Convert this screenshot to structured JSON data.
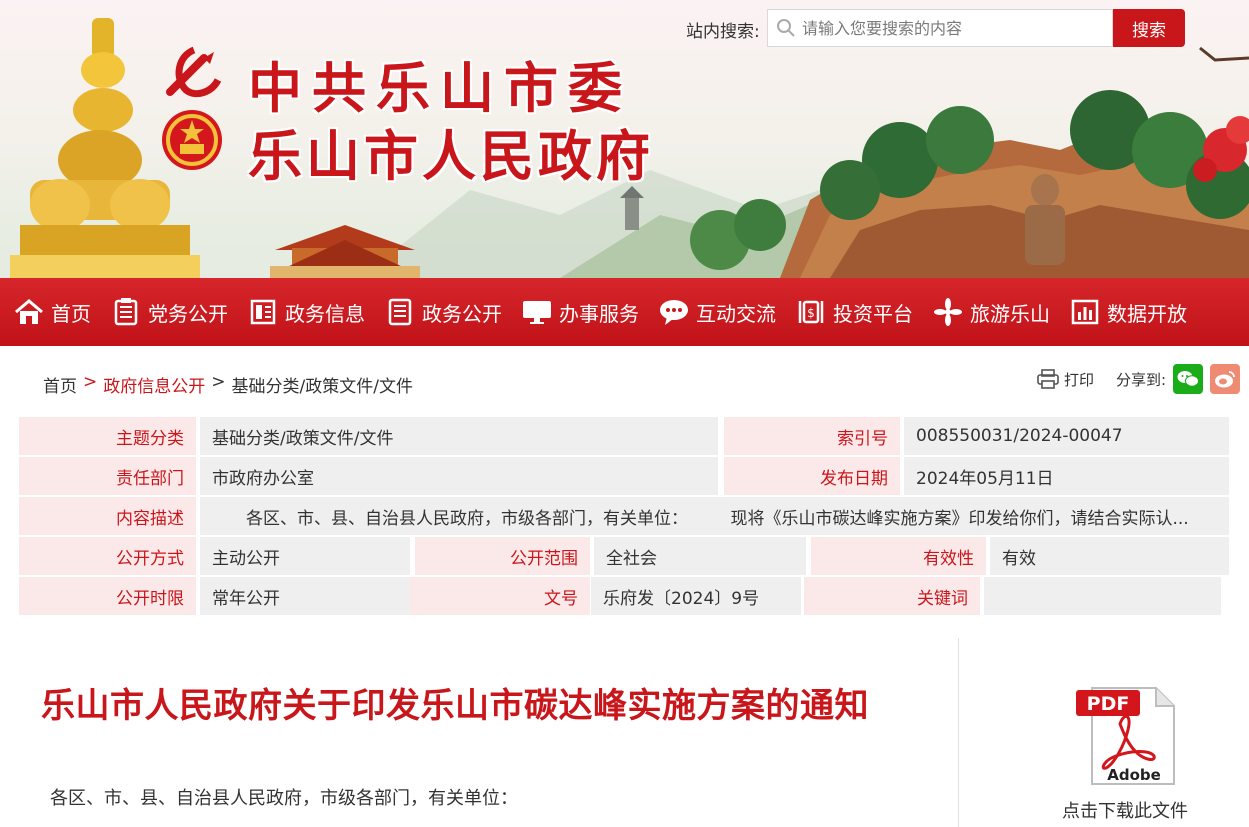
{
  "header": {
    "title_line1": "中共乐山市委",
    "title_line2": "乐山市人民政府",
    "search_label": "站内搜索:",
    "search_placeholder": "请输入您要搜索的内容",
    "search_button": "搜索",
    "brand_color": "#c9161b"
  },
  "nav": {
    "items": [
      {
        "label": "首页",
        "icon": "home-icon"
      },
      {
        "label": "党务公开",
        "icon": "document-icon"
      },
      {
        "label": "政务信息",
        "icon": "info-panel-icon"
      },
      {
        "label": "政务公开",
        "icon": "list-document-icon"
      },
      {
        "label": "办事服务",
        "icon": "monitor-icon"
      },
      {
        "label": "互动交流",
        "icon": "chat-bubble-icon"
      },
      {
        "label": "投资平台",
        "icon": "investment-icon"
      },
      {
        "label": "旅游乐山",
        "icon": "flower-icon"
      },
      {
        "label": "数据开放",
        "icon": "bar-chart-icon"
      }
    ]
  },
  "breadcrumb": {
    "home": "首页",
    "sep1": ">",
    "section": "政府信息公开",
    "sep2": ">",
    "current": "基础分类/政策文件/文件"
  },
  "tools": {
    "print": "打印",
    "share_label": "分享到:"
  },
  "meta": {
    "topic_label": "主题分类",
    "topic_value": "基础分类/政策文件/文件",
    "index_label": "索引号",
    "index_value": "008550031/2024-00047",
    "dept_label": "责任部门",
    "dept_value": "市政府办公室",
    "date_label": "发布日期",
    "date_value": "2024年05月11日",
    "desc_label": "内容描述",
    "desc_value": "　　各区、市、县、自治县人民政府，市级各部门，有关单位：　　　现将《乐山市碳达峰实施方案》印发给你们，请结合实际认...",
    "method_label": "公开方式",
    "method_value": "主动公开",
    "scope_label": "公开范围",
    "scope_value": "全社会",
    "validity_label": "有效性",
    "validity_value": "有效",
    "period_label": "公开时限",
    "period_value": "常年公开",
    "docno_label": "文号",
    "docno_value": "乐府发〔2024〕9号",
    "keyword_label": "关键词",
    "keyword_value": ""
  },
  "article": {
    "title": "乐山市人民政府关于印发乐山市碳达峰实施方案的通知",
    "salutation": "各区、市、县、自治县人民政府，市级各部门，有关单位："
  },
  "download": {
    "pdf_badge": "PDF",
    "adobe_text": "Adobe",
    "caption": "点击下载此文件"
  }
}
